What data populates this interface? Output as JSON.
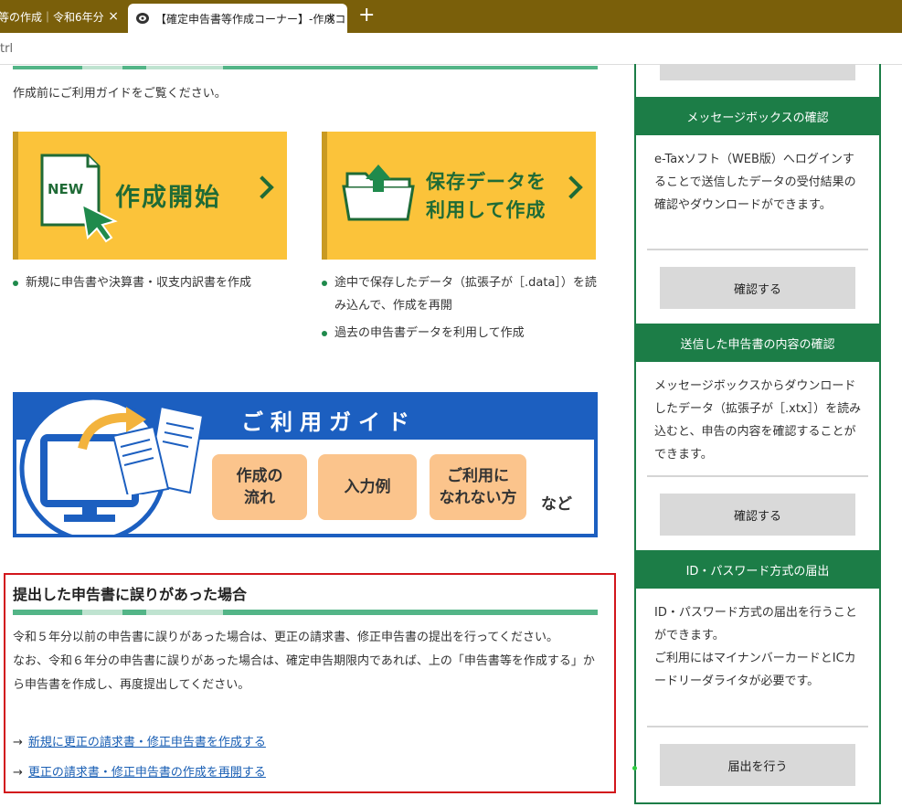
{
  "browser": {
    "tabs": [
      {
        "title": "等の作成｜令和6年分",
        "close": "×"
      },
      {
        "title": "【確定申告書等作成コーナー】-作成コ",
        "close": "×"
      }
    ],
    "new_tab": "+",
    "address": "trl"
  },
  "main": {
    "intro": "作成前にご利用ガイドをご覧ください。",
    "card_new": {
      "badge": "NEW",
      "title": "作成開始",
      "bullets": [
        "新規に申告書や決算書・収支内訳書を作成"
      ]
    },
    "card_saved": {
      "title_line1": "保存データを",
      "title_line2": "利用して作成",
      "bullets": [
        "途中で保存したデータ（拡張子が［.data］）を読み込んで、作成を再開",
        "過去の申告書データを利用して作成"
      ]
    },
    "guide": {
      "title": "ご利用ガイド",
      "buttons": [
        {
          "line1": "作成の",
          "line2": "流れ"
        },
        {
          "line1": "入力例",
          "line2": ""
        },
        {
          "line1": "ご利用に",
          "line2": "なれない方"
        }
      ],
      "etc": "など"
    },
    "error_section": {
      "title": "提出した申告書に誤りがあった場合",
      "para1": "令和５年分以前の申告書に誤りがあった場合は、更正の請求書、修正申告書の提出を行ってください。",
      "para2": "なお、令和６年分の申告書に誤りがあった場合は、確定申告期限内であれば、上の「申告書等を作成する」から申告書を作成し、再度提出してください。",
      "links": [
        {
          "arrow": "→",
          "text": "新規に更正の請求書・修正申告書を作成する"
        },
        {
          "arrow": "→",
          "text": "更正の請求書・修正申告書の作成を再開する"
        }
      ]
    }
  },
  "sidebar": {
    "sections": [
      {
        "heading": "メッセージボックスの確認",
        "text": "e-Taxソフト（WEB版）へログインすることで送信したデータの受付結果の確認やダウンロードができます。",
        "button": "確認する"
      },
      {
        "heading": "送信した申告書の内容の確認",
        "text": "メッセージボックスからダウンロードしたデータ（拡張子が［.xtx］）を読み込むと、申告の内容を確認することができます。",
        "button": "確認する"
      },
      {
        "heading": "ID・パスワード方式の届出",
        "text": "ID・パスワード方式の届出を行うことができます。",
        "text2": "ご利用にはマイナンバーカードとICカードリーダライタが必要です。",
        "button": "届出を行う"
      }
    ]
  },
  "colors": {
    "tabbar": "#7a5f0a",
    "card_yellow": "#fbc33a",
    "dark_green": "#1f6b36",
    "sidebar_green": "#1c7d47",
    "guide_blue": "#1c5fc0",
    "guide_button": "#fbc48c",
    "error_border": "#d2161c",
    "link_blue": "#1a5fb4"
  },
  "icons": [
    "close-icon",
    "plus-icon",
    "new-document-icon",
    "cursor-arrow-icon",
    "folder-upload-icon",
    "chevron-right-icon",
    "monitor-icon",
    "documents-icon",
    "curved-arrow-icon",
    "arrow-right-icon"
  ]
}
